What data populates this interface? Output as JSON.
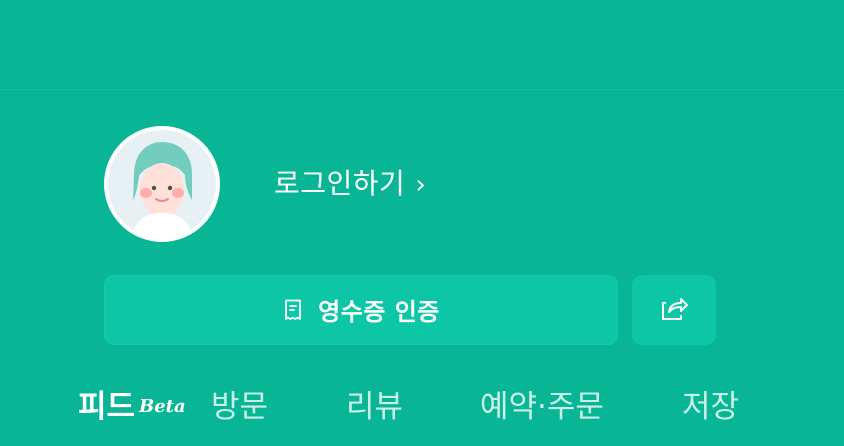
{
  "header": {
    "title": ""
  },
  "profile": {
    "login_label": "로그인하기",
    "login_arrow": "›",
    "avatar_icon": "profile-avatar-icon"
  },
  "actions": {
    "receipt_label": "영수증 인증",
    "receipt_icon": "receipt-icon",
    "share_icon": "share-icon"
  },
  "tabs": [
    {
      "label": "피드",
      "badge": "Beta",
      "active": true
    },
    {
      "label": "방문",
      "active": false
    },
    {
      "label": "리뷰",
      "active": false
    },
    {
      "label": "예약·주문",
      "active": false
    },
    {
      "label": "저장",
      "active": false
    }
  ],
  "colors": {
    "background": "#08b595",
    "button": "#0cc6a6",
    "text": "#ffffff"
  }
}
